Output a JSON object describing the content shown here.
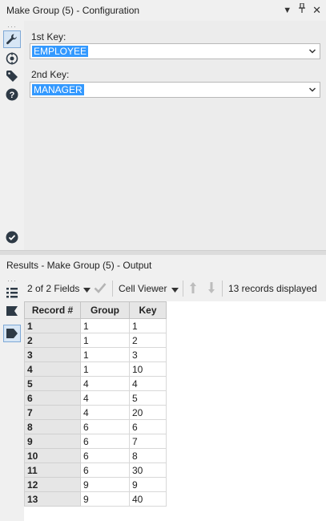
{
  "config_panel": {
    "title": "Make Group (5) - Configuration",
    "key1_label": "1st Key:",
    "key1_value": "EMPLOYEE",
    "key2_label": "2nd Key:",
    "key2_value": "MANAGER"
  },
  "results_panel": {
    "title": "Results - Make Group (5) - Output",
    "fields_selector": "2 of 2 Fields",
    "viewer_selector": "Cell Viewer",
    "records_status": "13 records displayed"
  },
  "table": {
    "headers": [
      "Record #",
      "Group",
      "Key"
    ],
    "rows": [
      [
        "1",
        "1",
        "1"
      ],
      [
        "2",
        "1",
        "2"
      ],
      [
        "3",
        "1",
        "3"
      ],
      [
        "4",
        "1",
        "10"
      ],
      [
        "5",
        "4",
        "4"
      ],
      [
        "6",
        "4",
        "5"
      ],
      [
        "7",
        "4",
        "20"
      ],
      [
        "8",
        "6",
        "6"
      ],
      [
        "9",
        "6",
        "7"
      ],
      [
        "10",
        "6",
        "8"
      ],
      [
        "11",
        "6",
        "30"
      ],
      [
        "12",
        "9",
        "9"
      ],
      [
        "13",
        "9",
        "40"
      ]
    ]
  },
  "colors": {
    "selection": "#3399ff",
    "header_bg": "#e6e6e6",
    "panel_bg": "#f0f0f0"
  },
  "icons": [
    "dropdown-arrow-icon",
    "pin-icon",
    "close-icon",
    "wrench-icon",
    "target-icon",
    "tag-icon",
    "help-icon",
    "check-circle-icon",
    "list-icon",
    "flag-icon",
    "tag-dark-icon",
    "checkmark-icon",
    "arrow-up-icon",
    "arrow-down-icon",
    "chevron-down-icon"
  ]
}
